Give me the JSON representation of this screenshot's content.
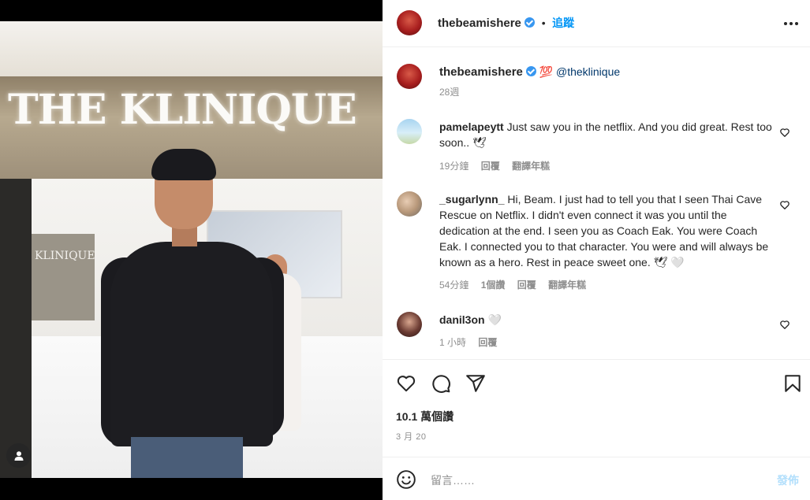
{
  "post": {
    "author": "thebeamishere",
    "follow_label": "追蹤",
    "separator": "•",
    "more_icon": "more-horizontal-icon",
    "caption": {
      "emoji": "💯",
      "mention": "@theklinique",
      "time": "28週"
    },
    "photo": {
      "sign_text": "THE KLINIQUE",
      "panel_text": "KLINIQUE"
    },
    "likes": "10.1 萬個讚",
    "date": "3 月 20"
  },
  "comments": [
    {
      "username": "pamelapeytt",
      "text": "Just saw you in the netflix. And you did great. Rest too soon.. 🕊",
      "time": "19分鐘",
      "reply": "回覆",
      "translate": "翻譯年糕"
    },
    {
      "username": "_sugarlynn_",
      "text": "Hi, Beam. I just had to tell you that I seen Thai Cave Rescue on Netflix. I didn't even connect it was you until the dedication at the end. I seen you as Coach Eak. You were Coach Eak. I connected you to that character. You were and will always be known as a hero. Rest in peace sweet one. 🕊 🤍",
      "time": "54分鐘",
      "likes": "1個讚",
      "reply": "回覆",
      "translate": "翻譯年糕"
    },
    {
      "username": "danil3on",
      "text": "🤍",
      "time": "1 小時",
      "reply": "回覆"
    }
  ],
  "composer": {
    "placeholder": "留言……",
    "post_label": "發佈"
  },
  "colors": {
    "accent": "#0095f6",
    "text": "#262626",
    "muted": "#8e8e8e",
    "post_disabled": "#b2dffc"
  }
}
